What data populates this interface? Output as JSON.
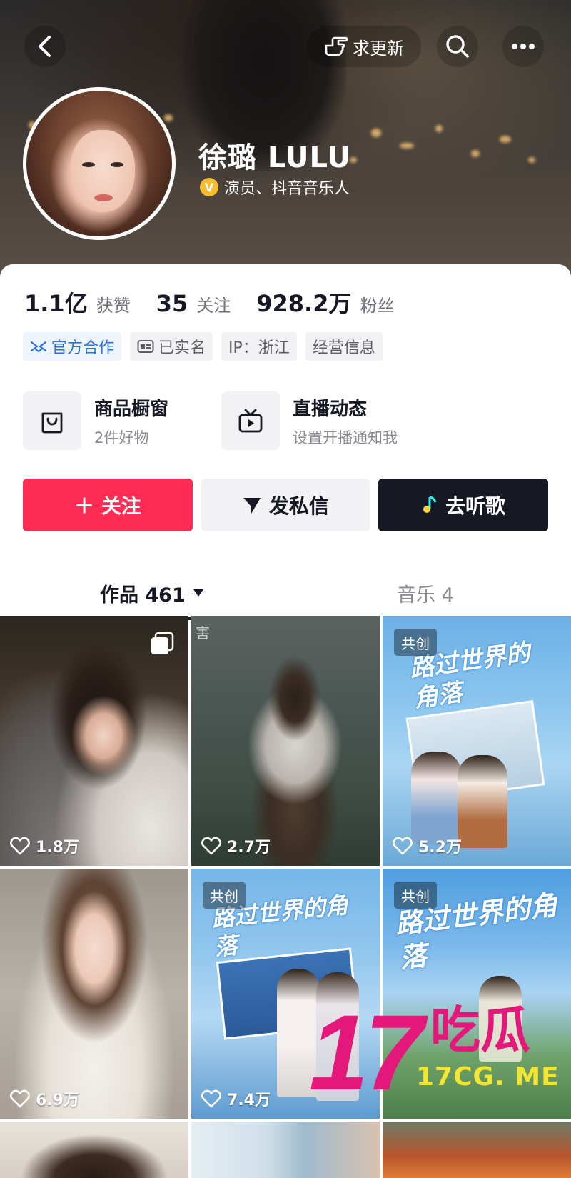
{
  "header": {
    "request_update_label": "求更新",
    "name": "徐璐 LULU",
    "verify_label": "V",
    "verify_text": "演员、抖音音乐人"
  },
  "stats": [
    {
      "value": "1.1亿",
      "label": "获赞"
    },
    {
      "value": "35",
      "label": "关注"
    },
    {
      "value": "928.2万",
      "label": "粉丝"
    }
  ],
  "tags": [
    "官方合作",
    "已实名",
    "IP：浙江",
    "经营信息"
  ],
  "features": [
    {
      "title": "商品橱窗",
      "subtitle": "2件好物",
      "icon": "shopping-bag-icon"
    },
    {
      "title": "直播动态",
      "subtitle": "设置开播通知我",
      "icon": "tv-icon"
    }
  ],
  "actions": {
    "follow": "＋ 关注",
    "message": "发私信",
    "music": "去听歌"
  },
  "tabs": {
    "works": "作品 461",
    "music": "音乐 4"
  },
  "videos": [
    {
      "likes": "1.8万",
      "badge": "",
      "title": ""
    },
    {
      "likes": "2.7万",
      "badge": "",
      "title": "害"
    },
    {
      "likes": "5.2万",
      "badge": "共创",
      "title": "路过世界的角落"
    },
    {
      "likes": "6.9万",
      "badge": "",
      "title": ""
    },
    {
      "likes": "7.4万",
      "badge": "共创",
      "title": "路过世界的角落"
    },
    {
      "likes": "",
      "badge": "共创",
      "title": "路过世界的角落"
    }
  ],
  "watermark": {
    "number": "17",
    "chars": "吃瓜",
    "url": "17CG. ME"
  },
  "colors": {
    "brand_red": "#fe2c55",
    "dark": "#161823",
    "verify_gold": "#f6bd2f",
    "watermark_pink": "#e3187a",
    "watermark_yellow": "#f4e531"
  }
}
